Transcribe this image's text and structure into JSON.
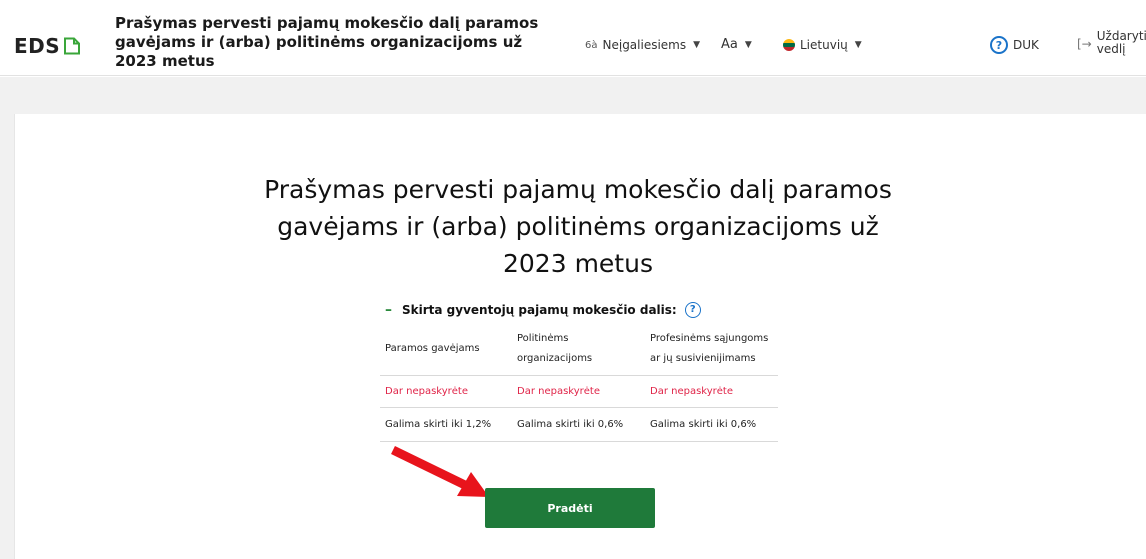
{
  "header": {
    "logo_text": "EDS",
    "title": "Prašymas pervesti pajamų mokesčio dalį paramos gavėjams ir (arba) politinėms organizacijoms už 2023 metus",
    "accessibility": {
      "icon": "6à",
      "label": "Neįgaliesiems"
    },
    "font_size_label": "Aa",
    "language": {
      "label": "Lietuvių"
    },
    "faq": {
      "icon": "?",
      "label": "DUK"
    },
    "close": {
      "icon": "[→",
      "label": "Uždaryti vedlį"
    }
  },
  "main": {
    "title": "Prašymas pervesti pajamų mokesčio dalį paramos gavėjams ir (arba) politinėms organizacijoms už 2023 metus",
    "section": {
      "toggle": "–",
      "title": "Skirta gyventojų pajamų mokesčio dalis:",
      "help_icon": "?"
    },
    "table": {
      "headers": [
        "Paramos gavėjams",
        "Politinėms organizacijoms",
        "Profesinėms sąjungoms ar jų susivienijimams"
      ],
      "status": [
        "Dar nepaskyrėte",
        "Dar nepaskyrėte",
        "Dar nepaskyrėte"
      ],
      "limits": [
        "Galima skirti iki 1,2%",
        "Galima skirti iki 0,6%",
        "Galima skirti iki 0,6%"
      ]
    },
    "start_button": "Pradėti"
  },
  "colors": {
    "accent_green": "#1f7a3a",
    "status_red": "#e02448",
    "help_blue": "#1a73c9",
    "arrow_red": "#e8141c",
    "page_gray": "#f1f1f1"
  }
}
